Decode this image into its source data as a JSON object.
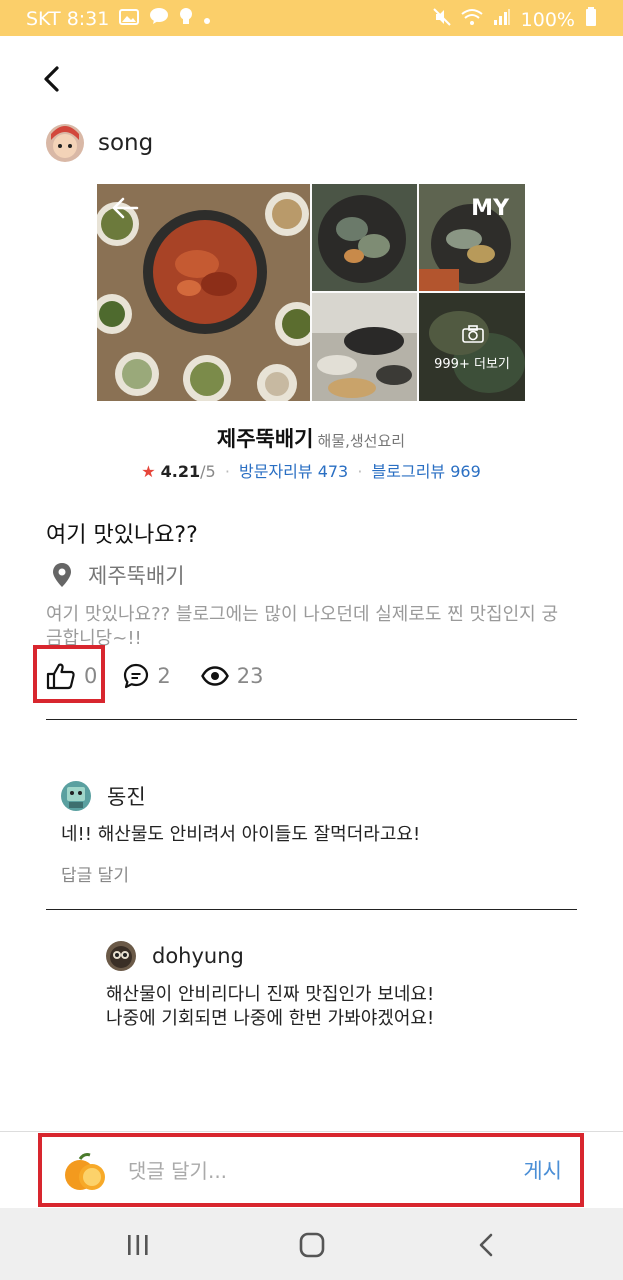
{
  "status_bar": {
    "carrier_time": "SKT 8:31",
    "battery": "100%"
  },
  "post": {
    "author": "song",
    "title": "여기 맛있나요??",
    "location": "제주뚝배기",
    "body": "여기 맛있나요?? 블로그에는 많이 나오던데 실제로도 찐 맛집인지 궁금합니당~!!",
    "likes": "0",
    "comments": "2",
    "views": "23"
  },
  "place_card": {
    "name": "제주뚝배기",
    "category": "해물,생선요리",
    "star": "★",
    "rating": "4.21",
    "rating_max": "/5",
    "visitor_reviews": "방문자리뷰 473",
    "blog_reviews": "블로그리뷰 969",
    "photo_my_label": "MY",
    "photo_more_label": "999+ 더보기"
  },
  "comments": [
    {
      "name": "동진",
      "text": "네!! 해산물도 안비려서 아이들도 잘먹더라고요!",
      "reply_label": "답글 달기"
    },
    {
      "name": "dohyung",
      "text_line1": "해산물이 안비리다니 진짜 맛집인가 보네요!",
      "text_line2": "나중에 기회되면 나중에 한번 가봐야겠어요!"
    }
  ],
  "comment_input": {
    "placeholder": "댓글 달기...",
    "submit_label": "게시"
  },
  "icons": {
    "back": "back-arrow-icon",
    "location": "map-pin-icon",
    "like": "thumbs-up-icon",
    "comment": "speech-bubble-icon",
    "views": "eye-icon"
  },
  "colors": {
    "status_bar": "#fbcf6a",
    "highlight_box": "#d8262e",
    "link_blue": "#2a6fc3",
    "post_button": "#4b8fd6",
    "star": "#e6453a"
  }
}
